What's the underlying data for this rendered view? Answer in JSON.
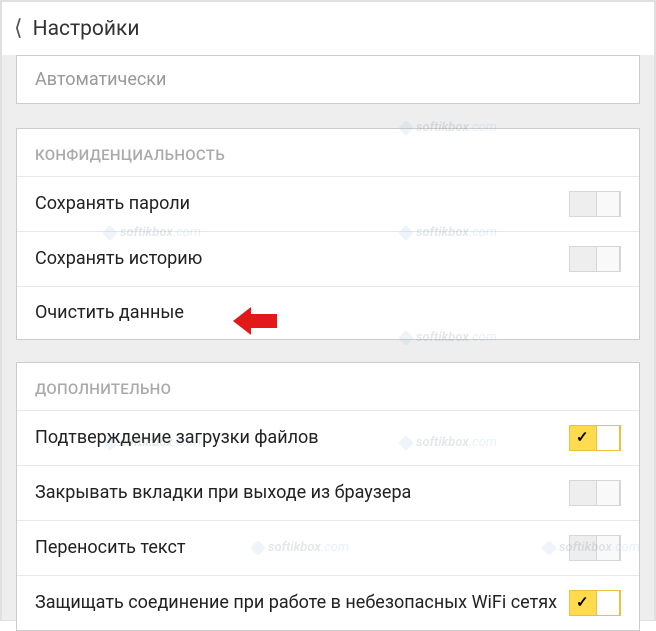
{
  "header": {
    "title": "Настройки"
  },
  "top_option": {
    "label": "Автоматически"
  },
  "sections": {
    "privacy": {
      "title": "КОНФИДЕНЦИАЛЬНОСТЬ",
      "items": {
        "save_passwords": {
          "label": "Сохранять пароли",
          "on": false
        },
        "save_history": {
          "label": "Сохранять историю",
          "on": false
        },
        "clear_data": {
          "label": "Очистить данные"
        }
      }
    },
    "additional": {
      "title": "ДОПОЛНИТЕЛЬНО",
      "items": {
        "confirm_downloads": {
          "label": "Подтверждение загрузки файлов",
          "on": true
        },
        "close_tabs_on_exit": {
          "label": "Закрывать вкладки при выходе из браузера",
          "on": false
        },
        "wrap_text": {
          "label": "Переносить текст",
          "on": false
        },
        "protect_wifi": {
          "label": "Защищать соединение при работе в небезопасных WiFi сетях",
          "on": true
        }
      }
    }
  },
  "watermark": {
    "text_a": "softikbox",
    "text_b": ".com"
  },
  "annotation": {
    "type": "arrow-left",
    "color": "#e31919"
  }
}
